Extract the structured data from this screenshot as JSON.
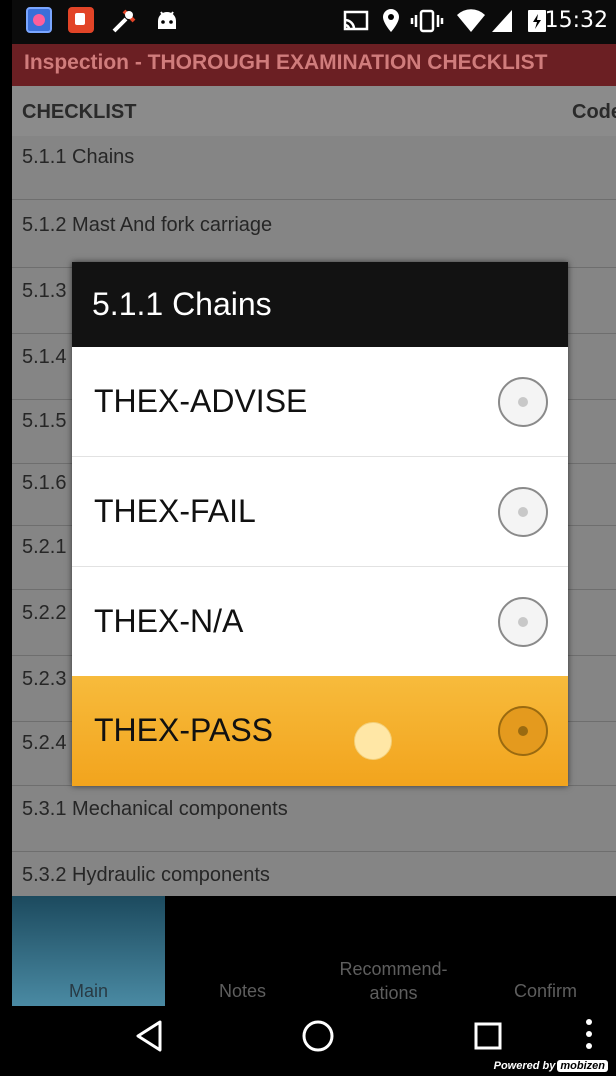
{
  "status_bar": {
    "time": "15:32",
    "left_icons": [
      "app-icon-1",
      "app-icon-2",
      "tools-icon",
      "android-icon"
    ],
    "right_icons": [
      "cast-icon",
      "location-icon",
      "vibrate-icon",
      "wifi-icon",
      "signal-icon",
      "battery-icon"
    ]
  },
  "title_bar": {
    "title": "Inspection - THOROUGH EXAMINATION CHECKLIST",
    "background_color": "#6b1f23"
  },
  "checklist": {
    "header_title": "CHECKLIST",
    "header_code": "Code",
    "rows": [
      "5.1.1 Chains",
      "5.1.2 Mast And fork carriage",
      "5.1.3 Hydraulics",
      "5.1.4",
      "5.1.5",
      "5.1.6",
      "5.2.1",
      "5.2.2",
      "5.2.3",
      "5.2.4",
      "5.3.1 Mechanical components",
      "5.3.2 Hydraulic components"
    ]
  },
  "dialog": {
    "title": "5.1.1 Chains",
    "options": [
      {
        "label": "THEX-ADVISE",
        "selected": false
      },
      {
        "label": "THEX-FAIL",
        "selected": false
      },
      {
        "label": "THEX-N/A",
        "selected": false
      },
      {
        "label": "THEX-PASS",
        "selected": true
      }
    ],
    "selected_color": "#f5b02e"
  },
  "tab_bar": {
    "tabs": [
      {
        "label": "Main",
        "active": true
      },
      {
        "label": "Notes",
        "active": false
      },
      {
        "label_line1": "Recommend-",
        "label_line2": "ations",
        "active": false
      },
      {
        "label": "Confirm",
        "active": false
      }
    ]
  },
  "nav_bar": {
    "icons": [
      "back-icon",
      "home-icon",
      "recents-icon",
      "overflow-icon"
    ],
    "powered_by": "Powered by",
    "powered_brand": "mobizen"
  }
}
